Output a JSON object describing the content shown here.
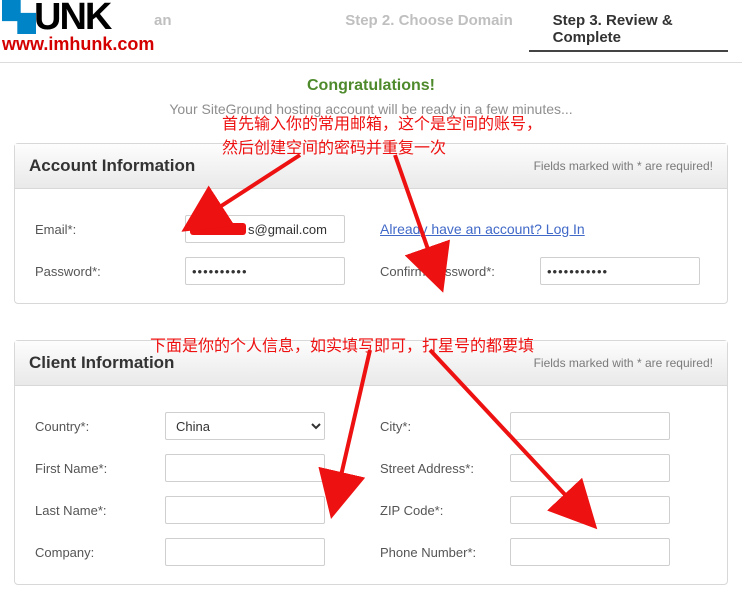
{
  "logo": {
    "text": "UNK",
    "site": "www.imhunk.com"
  },
  "steps": {
    "s1_visible": "an",
    "s2": "Step 2. Choose Domain",
    "s3": "Step 3. Review & Complete"
  },
  "congrats": "Congratulations!",
  "subtext": "Your SiteGround hosting account will be ready in a few minutes...",
  "required_note": "Fields marked with * are required!",
  "account": {
    "title": "Account Information",
    "email_label": "Email*:",
    "email_value": "s@gmail.com",
    "login_link": "Already have an account? Log In",
    "password_label": "Password*:",
    "confirm_label": "Confirm Password*:",
    "password_display": "••••••••••",
    "confirm_display": "•••••••••••"
  },
  "client": {
    "title": "Client Information",
    "country_label": "Country*:",
    "country_value": "China",
    "city_label": "City*:",
    "first_name_label": "First Name*:",
    "street_label": "Street Address*:",
    "last_name_label": "Last Name*:",
    "zip_label": "ZIP Code*:",
    "company_label": "Company:",
    "phone_label": "Phone Number*:"
  },
  "annotations": {
    "a1": "首先输入你的常用邮箱，这个是空间的账号，",
    "a2": "然后创建空间的密码并重复一次",
    "a3": "下面是你的个人信息，如实填写即可，打星号的都要填"
  }
}
